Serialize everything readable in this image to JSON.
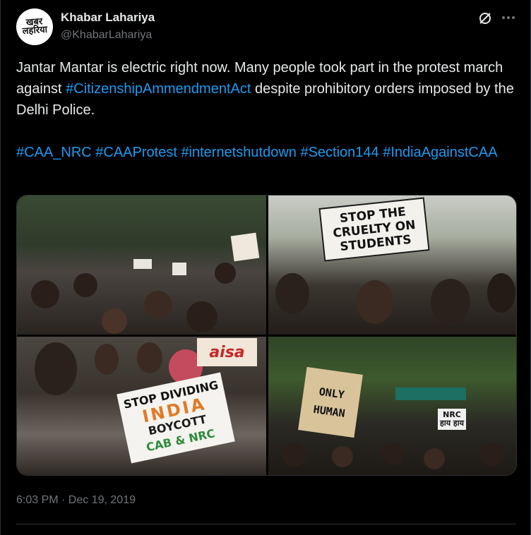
{
  "author": {
    "name": "Khabar Lahariya",
    "handle": "@KhabarLahariya",
    "avatar_text": "खबर लहरिया"
  },
  "tweet": {
    "p1_before": "Jantar Mantar is electric right now. Many people took part in the protest march against ",
    "p1_hashtag": "#CitizenshipAmmendmentAct",
    "p1_after": " despite prohibitory orders imposed by the Delhi Police.",
    "hashtags": [
      "#CAA_NRC",
      "#CAAProtest",
      "#internetshutdown",
      "#Section144",
      "#IndiaAgainstCAA"
    ]
  },
  "photos": {
    "photo2_sign": "STOP THE CRUELTY ON STUDENTS",
    "photo3_sign_l1": "STOP DIVIDING",
    "photo3_sign_l2": "INDIA",
    "photo3_sign_l3": "BOYCOTT",
    "photo3_sign_l4": "CAB & NRC",
    "photo3_banner": "aisa",
    "photo4_sign": "ONLY HUMAN",
    "photo4_sign_small": "NRC हाय हाय"
  },
  "meta": {
    "timestamp": "6:03 PM · Dec 19, 2019"
  },
  "icons": {
    "grok": "grok-icon",
    "more": "more-icon"
  },
  "colors": {
    "link": "#1d9bf0",
    "secondary_text": "#71767b",
    "primary_text": "#e7e9ea"
  }
}
